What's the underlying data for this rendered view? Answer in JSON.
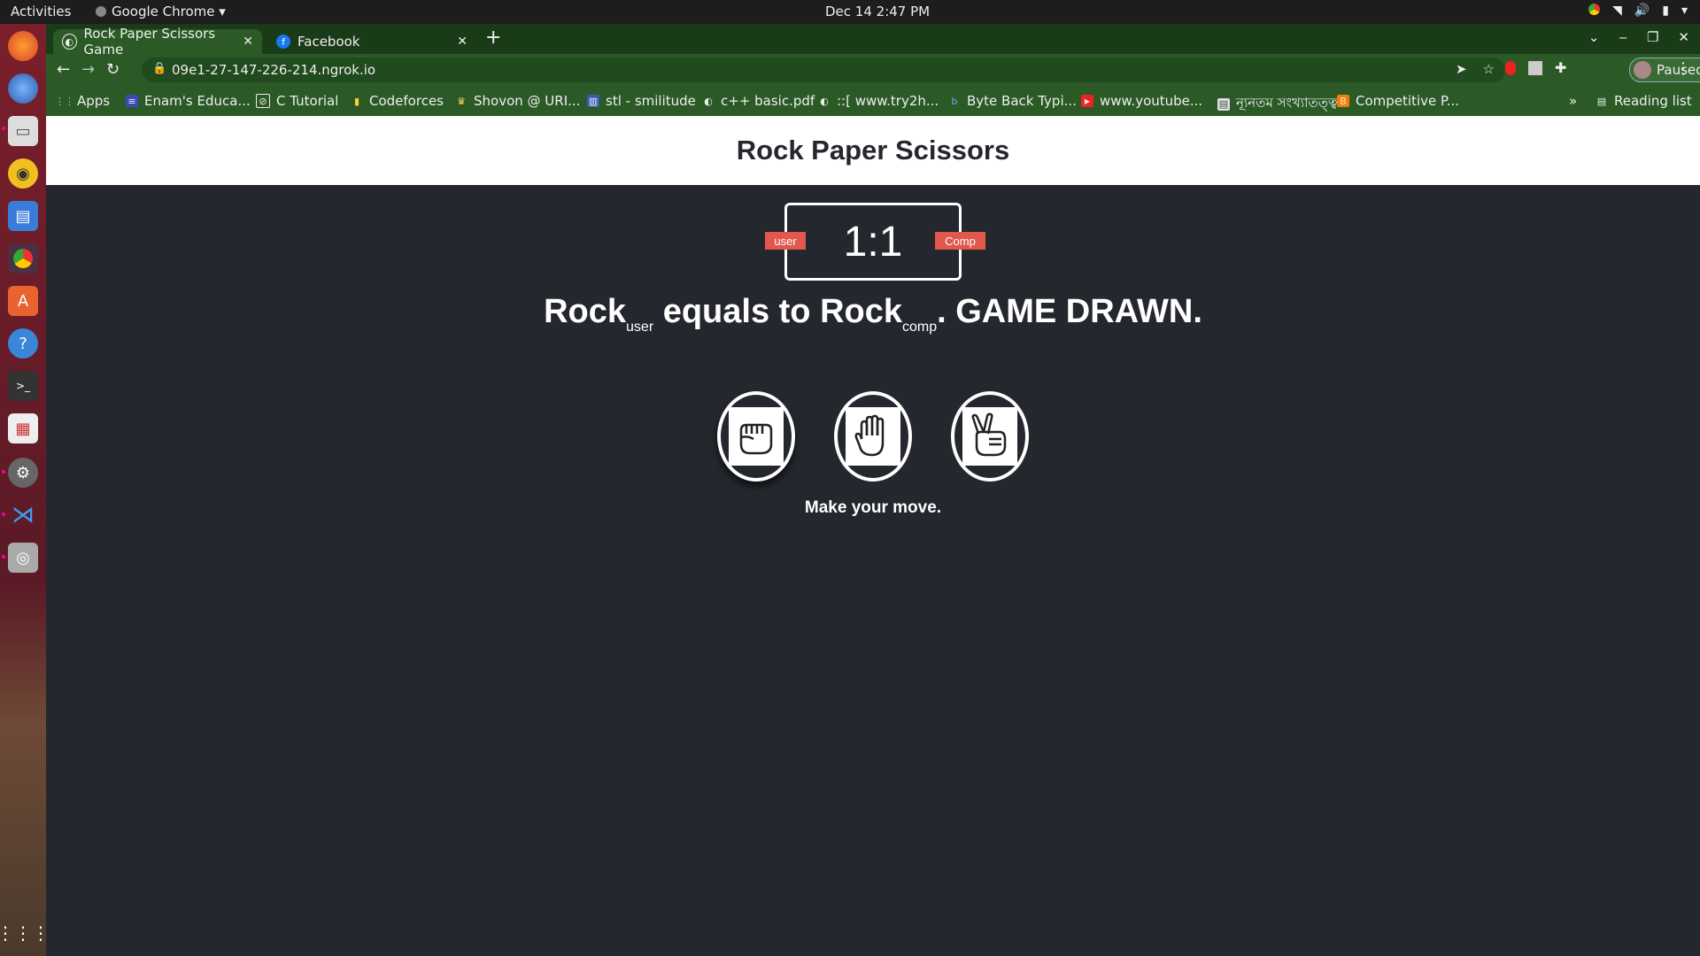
{
  "system": {
    "activities": "Activities",
    "app_menu": "Google Chrome ▾",
    "clock": "Dec 14  2:47 PM"
  },
  "browser": {
    "tabs": [
      {
        "title": "Rock Paper Scissors Game",
        "active": true
      },
      {
        "title": "Facebook",
        "active": false
      }
    ],
    "url": "09e1-27-147-226-214.ngrok.io",
    "profile_status": "Paused",
    "bookmarks": [
      {
        "label": "Apps",
        "icon": "apps-icon"
      },
      {
        "label": "Enam's Educa...",
        "icon": "site-icon"
      },
      {
        "label": "C Tutorial",
        "icon": "site-icon"
      },
      {
        "label": "Codeforces",
        "icon": "codeforces-icon"
      },
      {
        "label": "Shovon @ URI...",
        "icon": "trophy-icon"
      },
      {
        "label": "stl - smilitude",
        "icon": "site-icon"
      },
      {
        "label": "c++ basic.pdf",
        "icon": "globe-icon"
      },
      {
        "label": "::[ www.try2h...",
        "icon": "globe-icon"
      },
      {
        "label": "Byte Back Typi...",
        "icon": "site-icon"
      },
      {
        "label": "www.youtube...",
        "icon": "youtube-icon"
      },
      {
        "label": "ন্যূনতম সংখ্যাতত্ত্ব",
        "icon": "doc-icon"
      },
      {
        "label": "Competitive P...",
        "icon": "blogger-icon"
      }
    ],
    "reading_list": "Reading list",
    "overflow": "»"
  },
  "game": {
    "title": "Rock Paper Scissors",
    "score": {
      "user": 1,
      "comp": 1,
      "display": "1:1"
    },
    "user_badge": "user",
    "comp_badge": "Comp",
    "result": {
      "user_choice": "Rock",
      "user_sub": "user",
      "connector": " equals to ",
      "comp_choice": "Rock",
      "comp_sub": "comp",
      "outcome": ". GAME DRAWN."
    },
    "choices": [
      "Rock",
      "Paper",
      "Scissors"
    ],
    "action_message": "Make your move."
  },
  "colors": {
    "page_bg": "#24272e",
    "badge": "#e2584d",
    "chrome_frame": "#2b5a27"
  }
}
